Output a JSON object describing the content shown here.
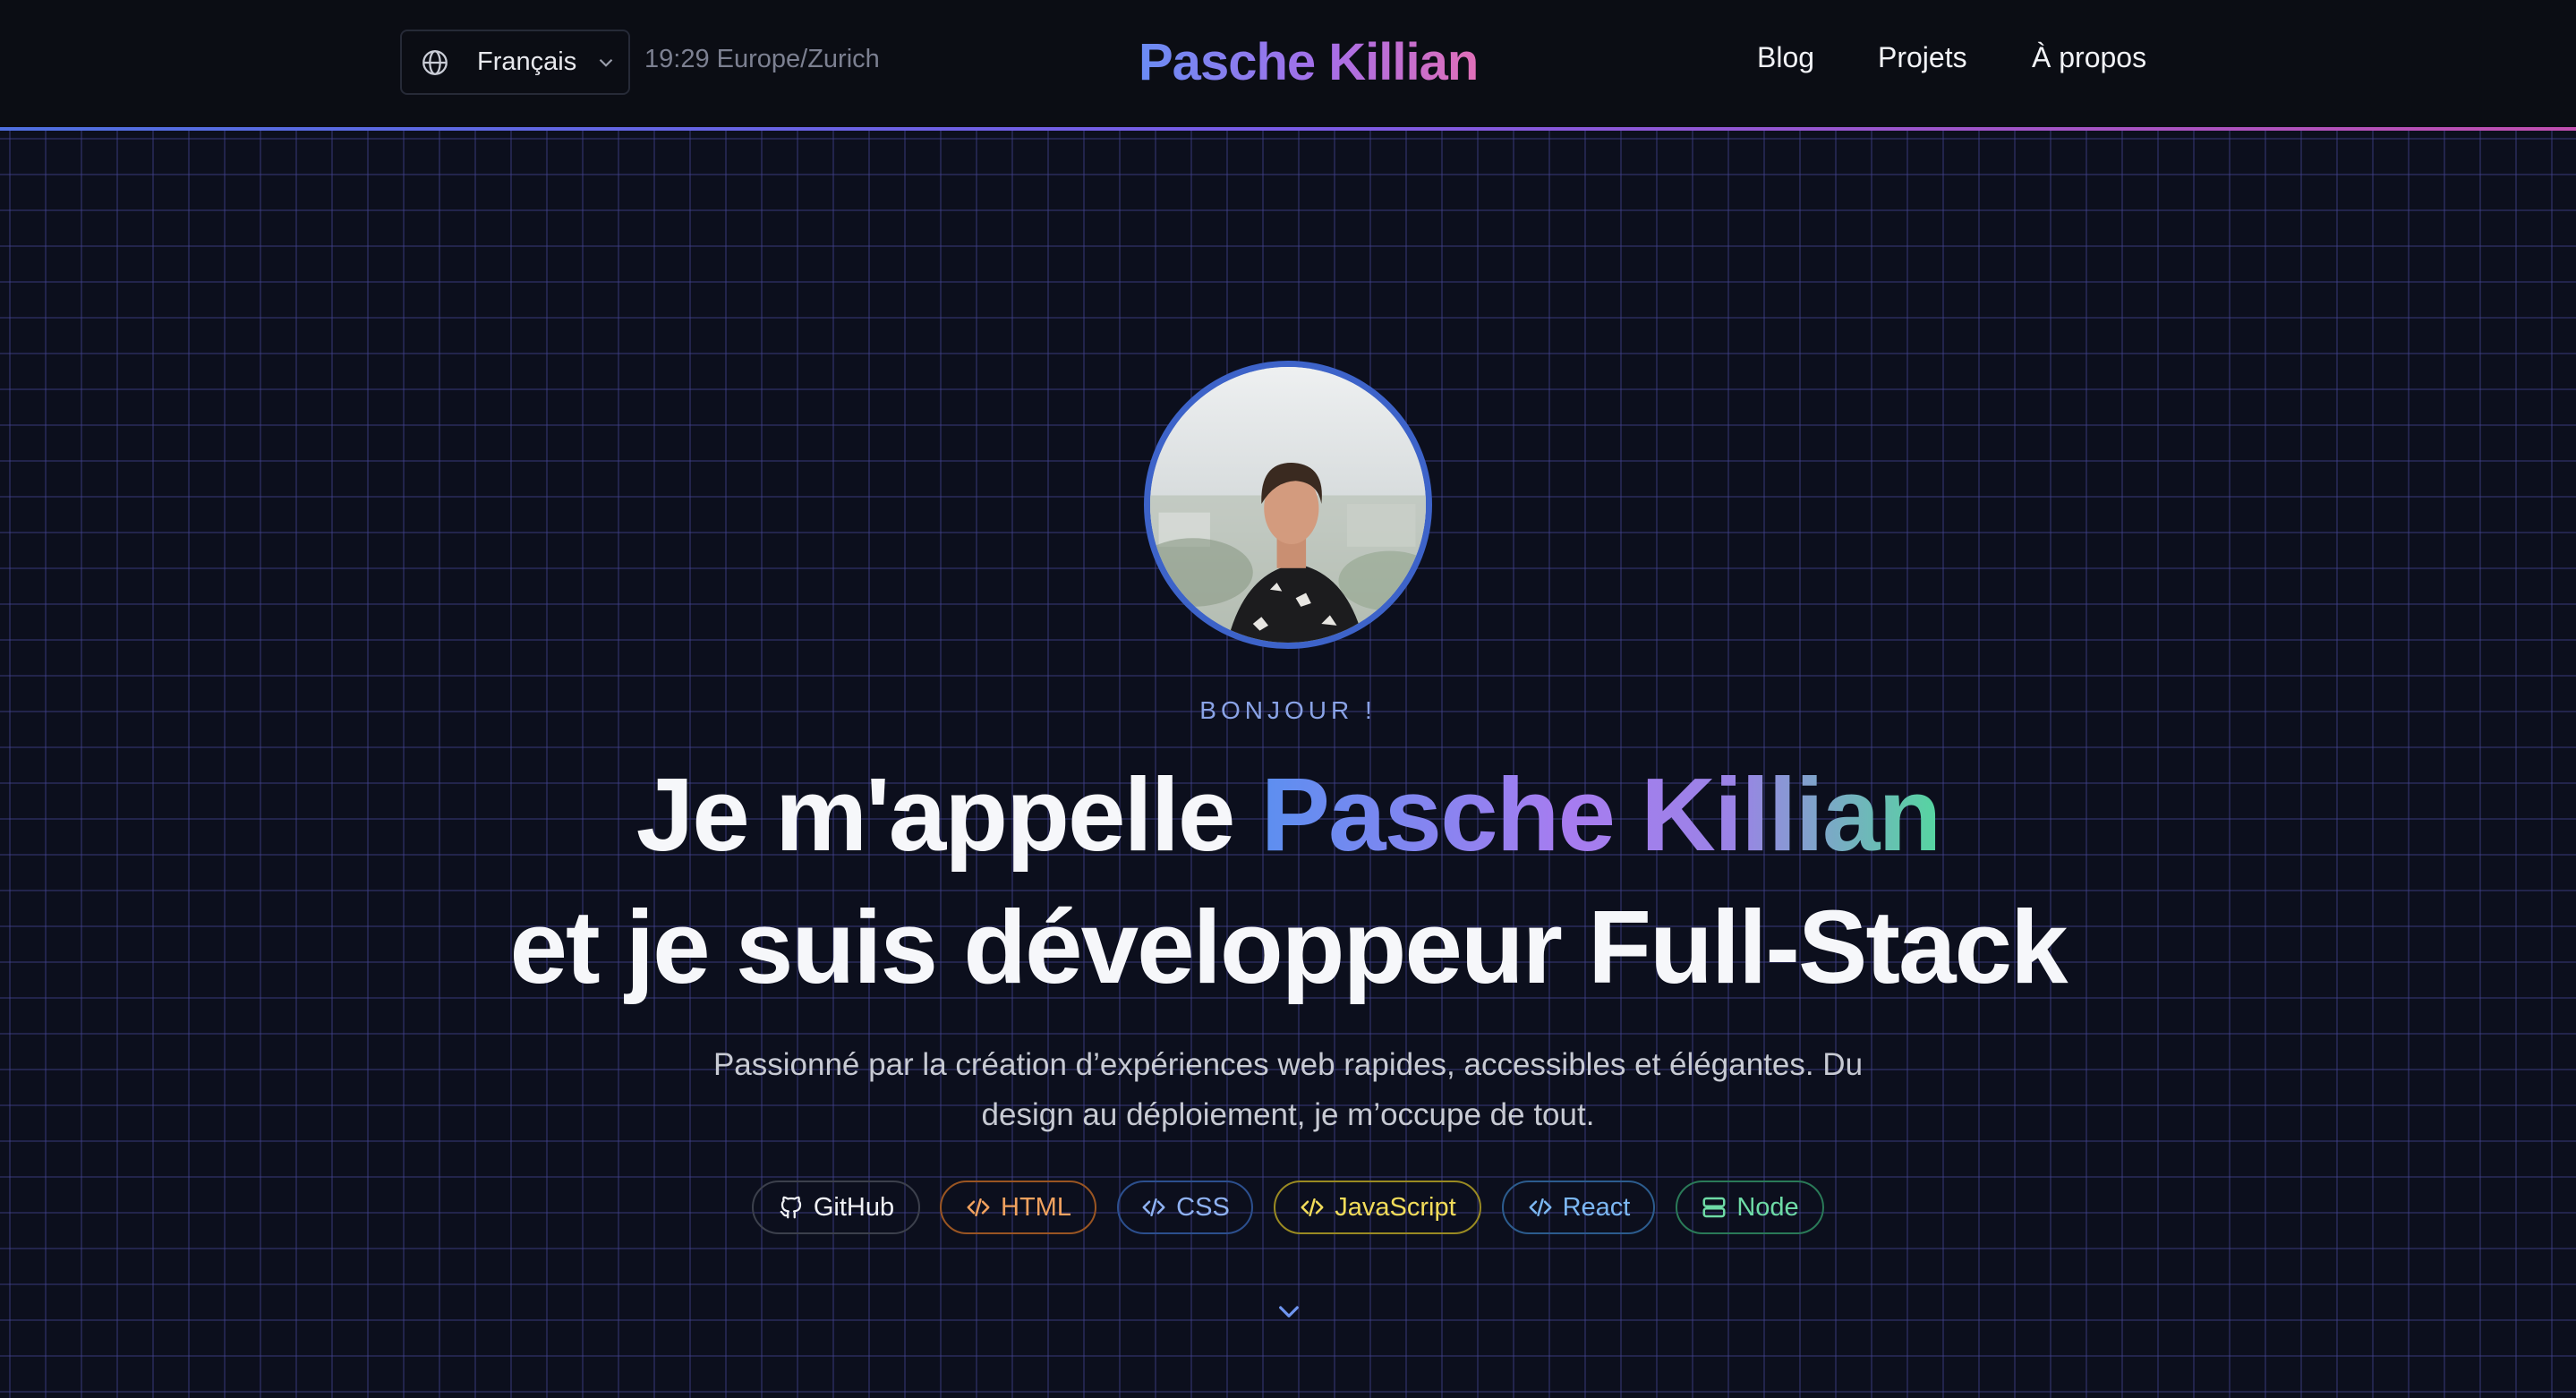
{
  "header": {
    "language": "Français",
    "clock": "19:29 Europe/Zurich",
    "brand": "Pasche Killian",
    "nav": {
      "blog": "Blog",
      "projets": "Projets",
      "apropos": "À propos"
    }
  },
  "hero": {
    "greeting": "BONJOUR !",
    "headline_prefix": "Je m'appelle ",
    "headline_name": "Pasche Killian",
    "headline_line2": "et je suis développeur Full-Stack",
    "description_line1": "Passionné par la création d’expériences web rapides, accessibles et élégantes. Du",
    "description_line2": "design au déploiement, je m’occupe de tout.",
    "tags": [
      {
        "label": "GitHub",
        "icon": "github-icon",
        "color": "#f1f2f6"
      },
      {
        "label": "HTML",
        "icon": "code-icon",
        "color": "#f2a25f"
      },
      {
        "label": "CSS",
        "icon": "code-icon",
        "color": "#8fb2f2"
      },
      {
        "label": "JavaScript",
        "icon": "code-icon",
        "color": "#f2dc5a"
      },
      {
        "label": "React",
        "icon": "code-icon",
        "color": "#7cb7f2"
      },
      {
        "label": "Node",
        "icon": "server-icon",
        "color": "#6edba6"
      }
    ]
  },
  "colors": {
    "background": "#0c0f1c",
    "accent_blue": "#3d63c9",
    "brand_gradient": [
      "#6a8cf4",
      "#a66ee8",
      "#e06fb8"
    ]
  }
}
